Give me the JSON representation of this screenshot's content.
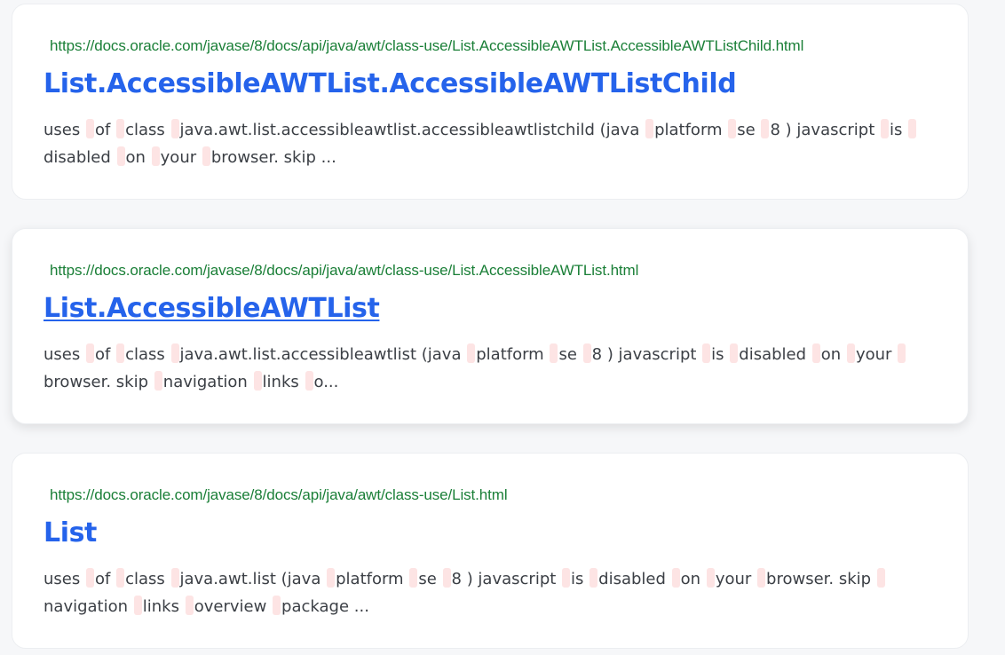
{
  "results": [
    {
      "url": "https://docs.oracle.com/javase/8/docs/api/java/awt/class-use/List.AccessibleAWTList.AccessibleAWTListChild.html",
      "title": "List.AccessibleAWTList.AccessibleAWTListChild",
      "hovered": false,
      "snippet_words": [
        "uses",
        "of",
        "class",
        "java.awt.list.accessibleawtlist.accessibleawtlistchild (java",
        "platform",
        "se",
        "8 ) javascript",
        "is",
        "disabled",
        "on",
        "your",
        "browser. skip ..."
      ]
    },
    {
      "url": "https://docs.oracle.com/javase/8/docs/api/java/awt/class-use/List.AccessibleAWTList.html",
      "title": "List.AccessibleAWTList",
      "hovered": true,
      "snippet_words": [
        "uses",
        "of",
        "class",
        "java.awt.list.accessibleawtlist (java",
        "platform",
        "se",
        "8 ) javascript",
        "is",
        "disabled",
        "on",
        "your",
        "browser. skip",
        "navigation",
        "links",
        "o..."
      ]
    },
    {
      "url": "https://docs.oracle.com/javase/8/docs/api/java/awt/class-use/List.html",
      "title": "List",
      "hovered": false,
      "snippet_words": [
        "uses",
        "of",
        "class",
        "java.awt.list (java",
        "platform",
        "se",
        "8 ) javascript",
        "is",
        "disabled",
        "on",
        "your",
        "browser. skip",
        "navigation",
        "links",
        "overview",
        "package ..."
      ]
    }
  ],
  "colors": {
    "url": "#1a7f37",
    "title": "#2563eb",
    "snippet": "#3b3f45",
    "highlight": "#fde4e4",
    "background": "#f6f7f9"
  }
}
